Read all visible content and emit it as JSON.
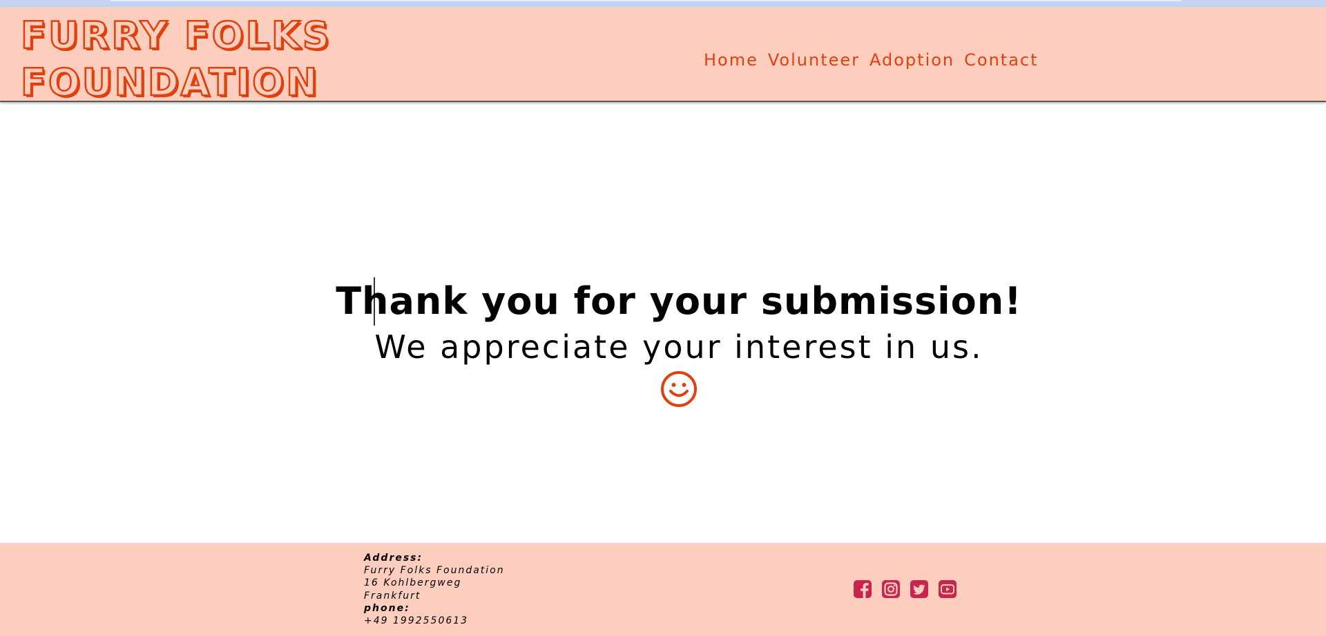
{
  "brand": {
    "name_line1": "Furry Folks",
    "name_line2": "Foundation",
    "accent_color": "#e0400e",
    "header_bg": "#fdcdbd"
  },
  "nav": {
    "items": [
      {
        "label": "Home"
      },
      {
        "label": "Volunteer"
      },
      {
        "label": "Adoption"
      },
      {
        "label": "Contact"
      }
    ]
  },
  "main": {
    "headline": "Thank you for your submission!",
    "subline": "We appreciate your interest in us.",
    "icon": "smiley-icon"
  },
  "footer": {
    "address_label": "Address:",
    "org_name": "Furry Folks Foundation",
    "street": "16 Kohlbergweg",
    "city": "Frankfurt",
    "phone_label": "phone:",
    "phone": "+49 1992550613",
    "social_color": "#c8254e",
    "social": [
      {
        "icon": "facebook-icon"
      },
      {
        "icon": "instagram-icon"
      },
      {
        "icon": "twitter-icon"
      },
      {
        "icon": "youtube-icon"
      }
    ]
  }
}
